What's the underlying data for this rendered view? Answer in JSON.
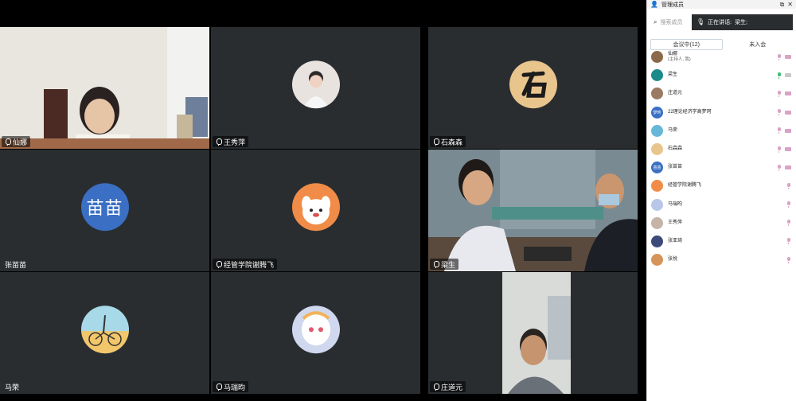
{
  "panel": {
    "title": "管理成员",
    "search_placeholder": "搜索成员",
    "speaking_label": "正在讲话:",
    "speaking_name": "梁生;",
    "tabs": [
      "会议中(12)",
      "未入会"
    ]
  },
  "tiles": [
    {
      "name": "仙娜",
      "mic": true
    },
    {
      "name": "王秀萍",
      "mic": true
    },
    {
      "name": "石森森",
      "mic": true
    },
    {
      "name": "张苗苗",
      "mic": false,
      "avatar_text": "苗苗"
    },
    {
      "name": "经管学院谢腾飞",
      "mic": true
    },
    {
      "name": "梁生",
      "mic": true
    },
    {
      "name": "马荣",
      "mic": false
    },
    {
      "name": "马瑞昀",
      "mic": true
    },
    {
      "name": "庄道元",
      "mic": true
    }
  ],
  "members": [
    {
      "name": "仙娜",
      "sub": "(主持人, 我)",
      "avatar_color": "#8a6a4a",
      "mic": "muted",
      "cam": "muted"
    },
    {
      "name": "梁生",
      "sub": "",
      "avatar_color": "#1b8a8a",
      "mic": "on",
      "cam": "gray"
    },
    {
      "name": "庄道元",
      "sub": "",
      "avatar_color": "#9a7a62",
      "mic": "muted",
      "cam": "muted"
    },
    {
      "name": "22理论经济学高梦珂",
      "sub": "",
      "avatar_color": "#3a6fc4",
      "avatar_text": "梦珂",
      "mic": "muted",
      "cam": "muted"
    },
    {
      "name": "马荣",
      "sub": "",
      "avatar_color": "#67b8d8",
      "mic": "muted",
      "cam": "muted"
    },
    {
      "name": "石森森",
      "sub": "",
      "avatar_color": "#e9c58e",
      "mic": "muted",
      "cam": "muted"
    },
    {
      "name": "张苗苗",
      "sub": "",
      "avatar_color": "#3a6fc4",
      "avatar_text": "苗苗",
      "mic": "muted",
      "cam": "muted"
    },
    {
      "name": "经管学院谢腾飞",
      "sub": "",
      "avatar_color": "#f08c48",
      "mic": "muted",
      "cam": ""
    },
    {
      "name": "马瑞昀",
      "sub": "",
      "avatar_color": "#b8c6e8",
      "mic": "muted",
      "cam": ""
    },
    {
      "name": "王秀萍",
      "sub": "",
      "avatar_color": "#c7b3a8",
      "mic": "muted",
      "cam": ""
    },
    {
      "name": "张亚琦",
      "sub": "",
      "avatar_color": "#3c4a7a",
      "mic": "muted",
      "cam": ""
    },
    {
      "name": "张悦",
      "sub": "",
      "avatar_color": "#d6945a",
      "mic": "muted",
      "cam": ""
    }
  ]
}
